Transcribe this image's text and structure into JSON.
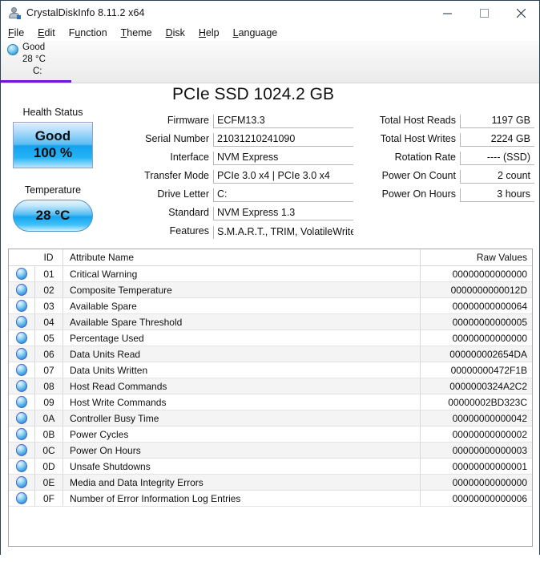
{
  "window": {
    "title": "CrystalDiskInfo 8.11.2 x64",
    "icon": "app-user-disk-icon",
    "controls": {
      "minimize": "minimize-icon",
      "maximize": "maximize-icon",
      "close": "close-icon"
    }
  },
  "menu": {
    "items": [
      {
        "label": "File",
        "accel": "F"
      },
      {
        "label": "Edit",
        "accel": "E"
      },
      {
        "label": "Function",
        "accel": "u"
      },
      {
        "label": "Theme",
        "accel": "T"
      },
      {
        "label": "Disk",
        "accel": "D"
      },
      {
        "label": "Help",
        "accel": "H"
      },
      {
        "label": "Language",
        "accel": "L"
      }
    ]
  },
  "disk_tabs": [
    {
      "status": "Good",
      "temperature": "28 °C",
      "drive_letter": "C:",
      "selected": true
    }
  ],
  "left_panel": {
    "health_label": "Health Status",
    "health_value": "Good",
    "health_percent": "100 %",
    "temperature_label": "Temperature",
    "temperature_value": "28 °C"
  },
  "drive": {
    "title": "PCIe SSD 1024.2 GB",
    "fields_left": [
      {
        "label": "Firmware",
        "value": "ECFM13.3"
      },
      {
        "label": "Serial Number",
        "value": "21031210241090"
      },
      {
        "label": "Interface",
        "value": "NVM Express"
      },
      {
        "label": "Transfer Mode",
        "value": "PCIe 3.0 x4 | PCIe 3.0 x4"
      },
      {
        "label": "Drive Letter",
        "value": "C:"
      },
      {
        "label": "Standard",
        "value": "NVM Express 1.3"
      },
      {
        "label": "Features",
        "value": "S.M.A.R.T., TRIM, VolatileWriteCache"
      }
    ],
    "fields_right": [
      {
        "label": "Total Host Reads",
        "value": "1197 GB"
      },
      {
        "label": "Total Host Writes",
        "value": "2224 GB"
      },
      {
        "label": "Rotation Rate",
        "value": "---- (SSD)"
      },
      {
        "label": "Power On Count",
        "value": "2 count"
      },
      {
        "label": "Power On Hours",
        "value": "3 hours"
      }
    ]
  },
  "attributes": {
    "columns": {
      "id": "ID",
      "name": "Attribute Name",
      "raw": "Raw Values"
    },
    "rows": [
      {
        "id": "01",
        "name": "Critical Warning",
        "raw": "00000000000000"
      },
      {
        "id": "02",
        "name": "Composite Temperature",
        "raw": "0000000000012D"
      },
      {
        "id": "03",
        "name": "Available Spare",
        "raw": "00000000000064"
      },
      {
        "id": "04",
        "name": "Available Spare Threshold",
        "raw": "00000000000005"
      },
      {
        "id": "05",
        "name": "Percentage Used",
        "raw": "00000000000000"
      },
      {
        "id": "06",
        "name": "Data Units Read",
        "raw": "000000002654DA"
      },
      {
        "id": "07",
        "name": "Data Units Written",
        "raw": "00000000472F1B"
      },
      {
        "id": "08",
        "name": "Host Read Commands",
        "raw": "0000000324A2C2"
      },
      {
        "id": "09",
        "name": "Host Write Commands",
        "raw": "00000002BD323C"
      },
      {
        "id": "0A",
        "name": "Controller Busy Time",
        "raw": "00000000000042"
      },
      {
        "id": "0B",
        "name": "Power Cycles",
        "raw": "00000000000002"
      },
      {
        "id": "0C",
        "name": "Power On Hours",
        "raw": "00000000000003"
      },
      {
        "id": "0D",
        "name": "Unsafe Shutdowns",
        "raw": "00000000000001"
      },
      {
        "id": "0E",
        "name": "Media and Data Integrity Errors",
        "raw": "00000000000000"
      },
      {
        "id": "0F",
        "name": "Number of Error Information Log Entries",
        "raw": "00000000000006"
      }
    ]
  },
  "colors": {
    "accent_tab": "#6a19d8",
    "good_blue": "#14a2ef",
    "window_border": "#2b4257"
  }
}
